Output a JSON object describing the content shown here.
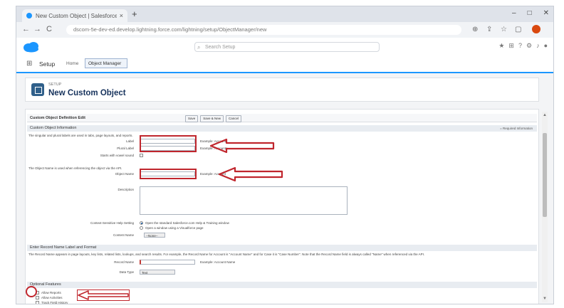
{
  "browser": {
    "tab_title": "New Custom Object | Salesforce",
    "tab_close": "×",
    "new_tab": "+",
    "window_controls": [
      "–",
      "□",
      "✕"
    ],
    "nav": [
      "←",
      "→",
      "C"
    ],
    "url": "dscom-5e-dev-ed.develop.lightning.force.com/lightning/setup/ObjectManager/new",
    "toolbar_icons": [
      "zoom-icon",
      "share-icon",
      "star-icon",
      "extensions-icon"
    ]
  },
  "header": {
    "search_placeholder": "Search Setup",
    "icons": [
      "favorites-icon",
      "add-icon",
      "help-icon",
      "setup-gear-icon",
      "bell-icon",
      "avatar-icon"
    ]
  },
  "setup_nav": {
    "setup_label": "Setup",
    "home_link": "Home",
    "object_manager_tab": "Object Manager"
  },
  "page": {
    "breadcrumb_small": "SETUP",
    "title": "New Custom Object"
  },
  "form": {
    "edit_header": "Custom Object Definition Edit",
    "buttons": [
      "Save",
      "Save & New",
      "Cancel"
    ],
    "section_info": "Custom Object Information",
    "required_info": "= Required Information",
    "singular_help": "The singular and plural labels are used in tabs, page layouts, and reports.",
    "label_label": "Label",
    "label_example": "Example: Account",
    "plural_label": "Plural Label",
    "plural_example": "Example: Accounts",
    "vowel_label": "Starts with vowel sound",
    "object_name_help": "The Object Name is used when referencing the object via the API.",
    "object_name_label": "Object Name",
    "object_name_example": "Example: Account",
    "description_label": "Description",
    "context_help_label": "Context-Sensitive Help Setting",
    "context_opt1": "Open the standard Salesforce.com Help & Training window",
    "context_opt2": "Open a window using a Visualforce page",
    "content_name_label": "Content Name",
    "content_name_value": "--None--",
    "record_name_section": "Enter Record Name Label and Format",
    "record_name_help": "The Record Name appears in page layouts, key lists, related lists, lookups, and search results. For example, the Record Name for Account is \"Account Name\" and for Case it is \"Case Number\". Note that the Record Name field is always called \"Name\" when referenced via the API.",
    "record_name_label": "Record Name",
    "record_name_example": "Example: Account Name",
    "data_type_label": "Data Type",
    "data_type_value": "Text",
    "optional_features": "Optional Features",
    "allow_reports": "Allow Reports",
    "allow_activities": "Allow Activities",
    "track_field_history": "Track Field History"
  },
  "colors": {
    "annotation_red": "#c0262d",
    "brand_blue": "#1b96ff",
    "title_navy": "#16325c"
  }
}
